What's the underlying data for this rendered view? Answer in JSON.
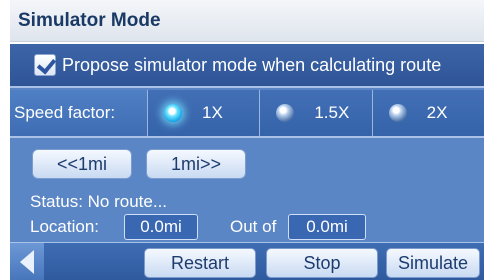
{
  "title": "Simulator Mode",
  "propose": {
    "checked": true,
    "label": "Propose simulator mode when calculating route"
  },
  "speed": {
    "label": "Speed factor:",
    "options": [
      {
        "label": "1X",
        "selected": true
      },
      {
        "label": "1.5X",
        "selected": false
      },
      {
        "label": "2X",
        "selected": false
      }
    ]
  },
  "nav": {
    "prev_label": "<<1mi",
    "next_label": "1mi>>"
  },
  "status_text": "Status: No route...",
  "location": {
    "label": "Location:",
    "value": "0.0mi",
    "outof_label": "Out of",
    "outof_value": "0.0mi"
  },
  "bottom": {
    "restart_label": "Restart",
    "stop_label": "Stop",
    "simulate_label": "Simulate"
  },
  "colors": {
    "panel": "#5b86c6",
    "header_text": "#1a3a66",
    "button_text": "#1d3c6e"
  }
}
